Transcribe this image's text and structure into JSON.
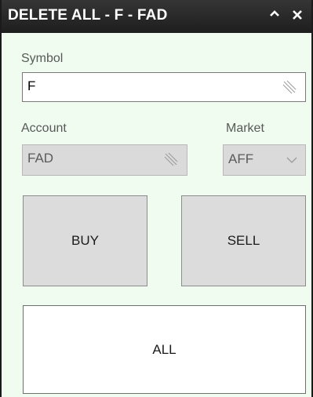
{
  "window": {
    "title": "DELETE ALL - F - FAD",
    "collapse_icon": "chevron-up-icon",
    "close_icon": "close-icon"
  },
  "symbol": {
    "label": "Symbol",
    "value": "F",
    "grip_icon": "resize-grip-icon"
  },
  "account": {
    "label": "Account",
    "value": "FAD",
    "enabled": false
  },
  "market": {
    "label": "Market",
    "value": "AFF",
    "enabled": false,
    "dropdown_icon": "chevron-down-icon"
  },
  "buttons": {
    "buy": "BUY",
    "sell": "SELL",
    "all": "ALL"
  },
  "colors": {
    "background": "#effcef",
    "titlebar": "#2a2a2a",
    "disabled_field": "#dadada",
    "side_button": "#dcdcdc"
  }
}
